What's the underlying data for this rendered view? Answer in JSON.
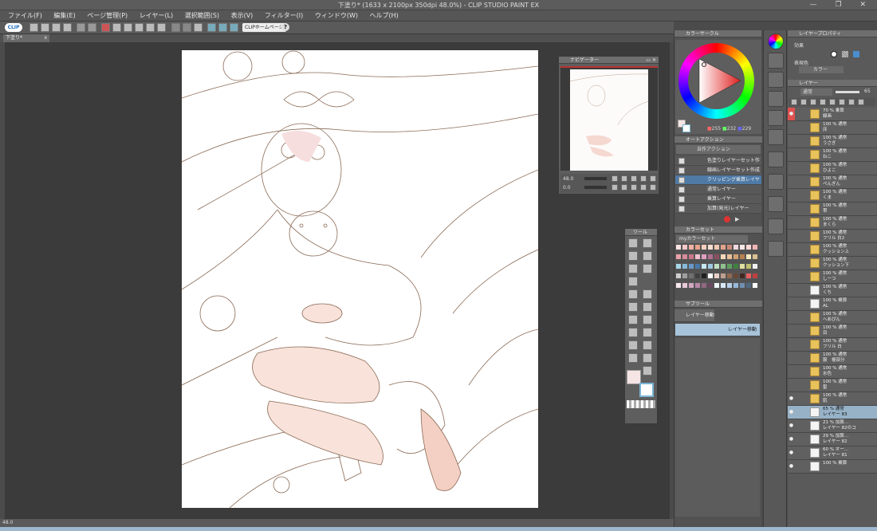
{
  "window": {
    "title": "下塗り* (1633 x 2100px 350dpi 48.0%) - CLIP STUDIO PAINT EX",
    "controls": "—  ❐  ✕"
  },
  "menu": [
    "ファイル(F)",
    "編集(E)",
    "ページ管理(P)",
    "レイヤー(L)",
    "選択範囲(S)",
    "表示(V)",
    "フィルター(I)",
    "ウィンドウ(W)",
    "ヘルプ(H)"
  ],
  "command_bar": {
    "logo": "CLIP",
    "home_button": "CLIPホームページ",
    "help": "?"
  },
  "document_tab": {
    "name": "下塗り*",
    "close": "x"
  },
  "navigator": {
    "title": "ナビゲーター",
    "zoom": "48.0",
    "rotation": "0.0"
  },
  "status_bar": {
    "zoom": "48.0"
  },
  "color_circle": {
    "title": "カラーサークル",
    "r": "255",
    "g": "232",
    "b": "229"
  },
  "auto_action": {
    "title": "オートアクション",
    "set_name": "自作アクション",
    "items": [
      {
        "label": "色塗りレイヤーセット作成",
        "checked": true,
        "selected": false
      },
      {
        "label": "線画レイヤーセット作成",
        "checked": true,
        "selected": false
      },
      {
        "label": "クリッピング乗算レイヤー",
        "checked": true,
        "selected": true
      },
      {
        "label": "通常レイヤー",
        "checked": true,
        "selected": false
      },
      {
        "label": "乗算レイヤー",
        "checked": true,
        "selected": false
      },
      {
        "label": "加算(発光)レイヤー",
        "checked": true,
        "selected": false
      }
    ]
  },
  "color_set": {
    "title": "カラーセット",
    "set_name": "myカラーセット",
    "colors": [
      "#fce4e4",
      "#f7c8c8",
      "#f3b3a6",
      "#e8a28c",
      "#f8d0c0",
      "#f6e0d0",
      "#f2c7b2",
      "#e2a48c",
      "#c98a7a",
      "#f0d8e0",
      "#f9e9e6",
      "#ffd6d6",
      "#f2b3b3",
      "#e9a0a8",
      "#d88c9c",
      "#c9758a",
      "#f0c0d0",
      "#e0a0c0",
      "#b07090",
      "#8a5060",
      "#f6d8b8",
      "#e8c098",
      "#d0a070",
      "#b88050",
      "#f6e8c0",
      "#d8c090",
      "#a8d8e8",
      "#88b8d8",
      "#6898c8",
      "#4878a8",
      "#c8e8f0",
      "#a0c8e0",
      "#c0e0c0",
      "#90c090",
      "#60a060",
      "#408040",
      "#e0e0a0",
      "#c0c070",
      "#f0f0f0",
      "#d0d0d0",
      "#a0a0a0",
      "#707070",
      "#404040",
      "#202020",
      "#ffffff",
      "#e8d0c8",
      "#c0a090",
      "#906850",
      "#684838",
      "#402820",
      "#e86060",
      "#c04040",
      "#f8e8f0",
      "#e8c8d8",
      "#d0a8c0",
      "#b888a8",
      "#906880",
      "#684860",
      "#f0f8ff",
      "#d8e8f8",
      "#b8d0e8",
      "#98b8d8",
      "#7090b0",
      "#506880",
      "#ffffff"
    ]
  },
  "sub_tool": {
    "title": "サブツール",
    "group": "レイヤー移動",
    "items": [
      "レイヤー移動"
    ]
  },
  "layer_property": {
    "title": "レイヤープロパティ",
    "effect_label": "効果",
    "color_label": "表現色",
    "color_value": "カラー"
  },
  "layers": {
    "title": "レイヤー",
    "blend_mode": "通常",
    "opacity": "65",
    "items": [
      {
        "pct": "70 %",
        "mode": "乗算",
        "name": "線画",
        "type": "folder",
        "visible": true,
        "red": true,
        "selected": false
      },
      {
        "pct": "100 %",
        "mode": "通常",
        "name": "床",
        "type": "folder",
        "visible": false,
        "red": false,
        "selected": false
      },
      {
        "pct": "100 %",
        "mode": "通常",
        "name": "うさぎ",
        "type": "folder",
        "visible": false,
        "red": false,
        "selected": false
      },
      {
        "pct": "100 %",
        "mode": "通常",
        "name": "ねこ",
        "type": "folder",
        "visible": false,
        "red": false,
        "selected": false
      },
      {
        "pct": "100 %",
        "mode": "通常",
        "name": "ひよこ",
        "type": "folder",
        "visible": false,
        "red": false,
        "selected": false
      },
      {
        "pct": "100 %",
        "mode": "通常",
        "name": "ぺんぎん",
        "type": "folder",
        "visible": false,
        "red": false,
        "selected": false
      },
      {
        "pct": "100 %",
        "mode": "通常",
        "name": "くま",
        "type": "folder",
        "visible": false,
        "red": false,
        "selected": false
      },
      {
        "pct": "100 %",
        "mode": "通常",
        "name": "帯",
        "type": "folder",
        "visible": false,
        "red": false,
        "selected": false
      },
      {
        "pct": "100 %",
        "mode": "通常",
        "name": "まくら",
        "type": "folder",
        "visible": false,
        "red": false,
        "selected": false
      },
      {
        "pct": "100 %",
        "mode": "通常",
        "name": "フリル 白2",
        "type": "folder",
        "visible": false,
        "red": false,
        "selected": false
      },
      {
        "pct": "100 %",
        "mode": "通常",
        "name": "クッション上",
        "type": "folder",
        "visible": false,
        "red": false,
        "selected": false
      },
      {
        "pct": "100 %",
        "mode": "通常",
        "name": "クッション下",
        "type": "folder",
        "visible": false,
        "red": false,
        "selected": false
      },
      {
        "pct": "100 %",
        "mode": "通常",
        "name": "しーつ",
        "type": "folder",
        "visible": false,
        "red": false,
        "selected": false
      },
      {
        "pct": "100 %",
        "mode": "通常",
        "name": "くち",
        "type": "image",
        "visible": false,
        "red": false,
        "selected": false
      },
      {
        "pct": "100 %",
        "mode": "乗算",
        "name": "AL",
        "type": "image",
        "visible": false,
        "red": false,
        "selected": false
      },
      {
        "pct": "100 %",
        "mode": "通常",
        "name": "へあぴん",
        "type": "folder",
        "visible": false,
        "red": false,
        "selected": false
      },
      {
        "pct": "100 %",
        "mode": "通常",
        "name": "目",
        "type": "folder",
        "visible": false,
        "red": false,
        "selected": false
      },
      {
        "pct": "100 %",
        "mode": "通常",
        "name": "フリル 白",
        "type": "folder",
        "visible": false,
        "red": false,
        "selected": false
      },
      {
        "pct": "100 %",
        "mode": "通常",
        "name": "服　複部分",
        "type": "folder",
        "visible": false,
        "red": false,
        "selected": false
      },
      {
        "pct": "100 %",
        "mode": "通常",
        "name": "水色",
        "type": "folder",
        "visible": false,
        "red": false,
        "selected": false
      },
      {
        "pct": "100 %",
        "mode": "通常",
        "name": "髪",
        "type": "folder",
        "visible": false,
        "red": false,
        "selected": false
      },
      {
        "pct": "100 %",
        "mode": "通常",
        "name": "肌",
        "type": "folder",
        "visible": true,
        "red": false,
        "selected": false
      },
      {
        "pct": "65 %",
        "mode": "通常",
        "name": "レイヤー 83",
        "type": "image",
        "visible": true,
        "red": false,
        "selected": true
      },
      {
        "pct": "21 %",
        "mode": "加算…",
        "name": "レイヤー 82のコ",
        "type": "image",
        "visible": true,
        "red": false,
        "selected": false
      },
      {
        "pct": "29 %",
        "mode": "加算…",
        "name": "レイヤー 82",
        "type": "image",
        "visible": true,
        "red": false,
        "selected": false
      },
      {
        "pct": "60 %",
        "mode": "オー…",
        "name": "レイヤー 81",
        "type": "image",
        "visible": true,
        "red": false,
        "selected": false
      },
      {
        "pct": "100 %",
        "mode": "乗算",
        "name": "",
        "type": "image",
        "visible": true,
        "red": false,
        "selected": false
      }
    ]
  },
  "colors": {
    "accent": "#4f7aa6",
    "selection": "#97b2c7",
    "eye_red": "#e05050",
    "folder": "#e8c25a",
    "main_color": "#f6e5e5",
    "sub_color": "#ffffff"
  }
}
